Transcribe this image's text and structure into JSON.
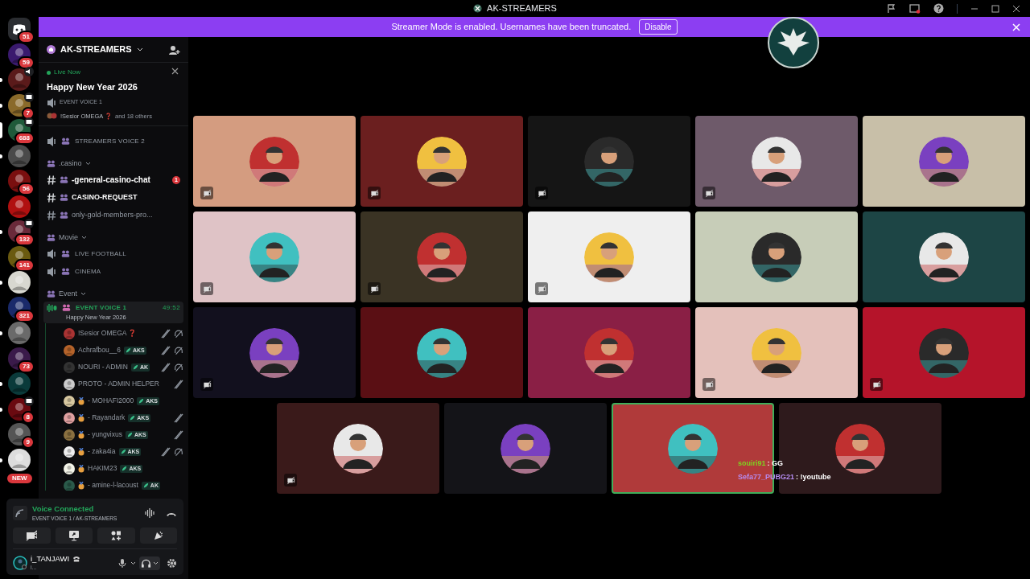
{
  "window": {
    "title": "AK-STREAMERS"
  },
  "servers": [
    {
      "badge": "51",
      "in_voice": false,
      "screen_share": false,
      "selected": false,
      "unread": false,
      "color": "#2b2d31",
      "kind": "home"
    },
    {
      "badge": "59",
      "in_voice": false,
      "screen_share": false,
      "selected": false,
      "unread": false,
      "color": "#3a1a6e",
      "kind": "server"
    },
    {
      "in_voice": true,
      "screen_share": false,
      "selected": false,
      "unread": true,
      "color": "#5a1a1a",
      "kind": "server"
    },
    {
      "badge": "7",
      "in_voice": false,
      "screen_share": true,
      "selected": false,
      "unread": true,
      "color": "#8a6a2a",
      "kind": "server"
    },
    {
      "badge": "688",
      "in_voice": false,
      "screen_share": true,
      "selected": true,
      "unread": false,
      "color": "#1f5a3a",
      "kind": "server"
    },
    {
      "in_voice": false,
      "screen_share": false,
      "selected": false,
      "unread": true,
      "color": "#4a4a4a",
      "kind": "server"
    },
    {
      "badge": "56",
      "in_voice": false,
      "screen_share": false,
      "selected": false,
      "unread": false,
      "color": "#7a0f0f",
      "kind": "server"
    },
    {
      "in_voice": false,
      "screen_share": false,
      "selected": false,
      "unread": false,
      "color": "#b01010",
      "kind": "server"
    },
    {
      "badge": "132",
      "in_voice": false,
      "screen_share": true,
      "selected": false,
      "unread": true,
      "color": "#6a2a3a",
      "kind": "server"
    },
    {
      "badge": "141",
      "in_voice": false,
      "screen_share": false,
      "selected": false,
      "unread": false,
      "color": "#6a5a10",
      "kind": "server"
    },
    {
      "in_voice": false,
      "screen_share": false,
      "selected": false,
      "unread": true,
      "color": "#d8d8d0",
      "kind": "server"
    },
    {
      "badge": "321",
      "in_voice": false,
      "screen_share": false,
      "selected": false,
      "unread": false,
      "color": "#1a2a6a",
      "kind": "server"
    },
    {
      "in_voice": false,
      "screen_share": false,
      "selected": false,
      "unread": true,
      "color": "#6a6a6a",
      "kind": "server"
    },
    {
      "badge": "73",
      "in_voice": false,
      "screen_share": false,
      "selected": false,
      "unread": false,
      "color": "#3a1a4a",
      "kind": "server"
    },
    {
      "in_voice": false,
      "screen_share": false,
      "selected": false,
      "unread": true,
      "color": "#0a3a3a",
      "kind": "server"
    },
    {
      "badge": "8",
      "in_voice": false,
      "screen_share": true,
      "selected": false,
      "unread": true,
      "color": "#6a0a10",
      "kind": "server"
    },
    {
      "badge": "9",
      "in_voice": false,
      "screen_share": false,
      "selected": false,
      "unread": false,
      "color": "#555555",
      "kind": "server"
    },
    {
      "badge": "NEW",
      "in_voice": false,
      "screen_share": false,
      "selected": false,
      "unread": true,
      "color": "#dddddd",
      "kind": "new"
    }
  ],
  "banner": {
    "text": "Streamer Mode is enabled. Usernames have been truncated.",
    "button": "Disable"
  },
  "sidebar": {
    "server_name": "AK-STREAMERS",
    "live_event": {
      "status": "Live Now",
      "title": "Happy New Year 2026",
      "channel": "EVENT VOICE 1",
      "host": "!Sesior OMEGA ❓",
      "others": "and 18 others"
    },
    "channels": [
      {
        "kind": "voice",
        "name": "STREAMERS VOICE 2"
      },
      {
        "kind": "category",
        "name": ".casino"
      },
      {
        "kind": "text",
        "name": "-general-casino-chat",
        "unread": true,
        "badge": "1"
      },
      {
        "kind": "text",
        "name": "CASINO-REQUEST",
        "unread": true
      },
      {
        "kind": "text",
        "name": "only-gold-members-pro...",
        "unread": false
      },
      {
        "kind": "category",
        "name": "Movie"
      },
      {
        "kind": "voice",
        "name": "LIVE FOOTBALL"
      },
      {
        "kind": "voice",
        "name": "CINEMA"
      },
      {
        "kind": "category",
        "name": "Event"
      },
      {
        "kind": "active_voice",
        "name": "EVENT VOICE 1",
        "timer": "49:52",
        "subtitle": "Happy New Year 2026",
        "members": [
          {
            "name": "!Sesior OMEGA ❓",
            "muted": true,
            "deafened": true,
            "medal": false
          },
          {
            "name": "Achrafbou__6",
            "tag": "AKS",
            "muted": true,
            "deafened": true,
            "medal": false
          },
          {
            "name": "NOURI - ADMIN",
            "tag": "AK",
            "muted": true,
            "deafened": true,
            "medal": false
          },
          {
            "name": "PROTO - ADMIN HELPER",
            "muted": true,
            "deafened": false,
            "medal": false
          },
          {
            "name": "- MOHAFI2000",
            "tag": "AKS",
            "muted": false,
            "deafened": false,
            "medal": true
          },
          {
            "name": "- Rayandark",
            "tag": "AKS",
            "muted": true,
            "deafened": false,
            "medal": true
          },
          {
            "name": "- yungvixus",
            "tag": "AKS",
            "muted": true,
            "deafened": false,
            "medal": true
          },
          {
            "name": "- zaka4ia",
            "tag": "AKS",
            "muted": true,
            "deafened": true,
            "medal": true
          },
          {
            "name": "HAKIM23",
            "tag": "AKS",
            "muted": false,
            "deafened": false,
            "medal": true
          },
          {
            "name": "- amine-l-lacoust",
            "tag": "AK",
            "muted": false,
            "deafened": false,
            "medal": true
          }
        ]
      }
    ]
  },
  "voice_panel": {
    "status": "Voice Connected",
    "channel": "EVENT VOICE 1 / AK-STREAMERS"
  },
  "user": {
    "name": "i_TANJAWI",
    "status": "i..."
  },
  "tiles": [
    {
      "color": "#d49c80",
      "camera_off": true,
      "speaking": false
    },
    {
      "color": "#6b1f1f",
      "camera_off": true,
      "speaking": false
    },
    {
      "color": "#151515",
      "camera_off": true,
      "speaking": false
    },
    {
      "color": "#6e5a6a",
      "camera_off": true,
      "speaking": false
    },
    {
      "color": "#c8bfa8",
      "camera_off": false,
      "speaking": false
    },
    {
      "color": "#dfc3c6",
      "camera_off": true,
      "speaking": false
    },
    {
      "color": "#3a3324",
      "camera_off": true,
      "speaking": false
    },
    {
      "color": "#efefef",
      "camera_off": true,
      "speaking": false
    },
    {
      "color": "#c7cdb8",
      "camera_off": false,
      "speaking": false
    },
    {
      "color": "#1d4545",
      "camera_off": false,
      "speaking": false
    },
    {
      "color": "#12101e",
      "camera_off": true,
      "speaking": false
    },
    {
      "color": "#5a0f14",
      "camera_off": false,
      "speaking": false
    },
    {
      "color": "#8a1f45",
      "camera_off": false,
      "speaking": false
    },
    {
      "color": "#e4c1bb",
      "camera_off": true,
      "speaking": false
    },
    {
      "color": "#b5142a",
      "camera_off": true,
      "speaking": false
    },
    {
      "color": "#3a1a1a",
      "camera_off": true,
      "speaking": false
    },
    {
      "color": "#141418",
      "camera_off": false,
      "speaking": false
    },
    {
      "color": "#b03a3a",
      "camera_off": false,
      "speaking": true
    },
    {
      "color": "#2e1a1c",
      "camera_off": false,
      "speaking": false
    }
  ],
  "chat_overlay": [
    {
      "user": "souiri91",
      "color": "#7ed321",
      "text": ": GG"
    },
    {
      "user": "Sefa77_PUBG21",
      "color": "#b58cf0",
      "text": ": !youtube"
    }
  ]
}
